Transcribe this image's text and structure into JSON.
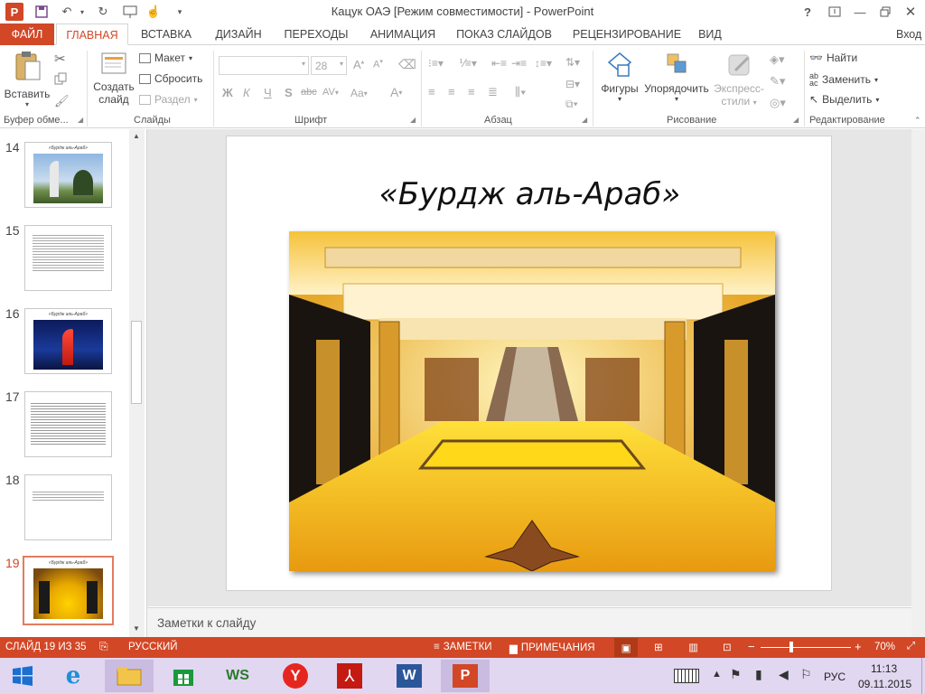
{
  "window": {
    "title": "Кацук ОАЭ [Режим совместимости] - PowerPoint"
  },
  "titlebar_right": {
    "help": "?"
  },
  "tabs": [
    "ФАЙЛ",
    "ГЛАВНАЯ",
    "ВСТАВКА",
    "ДИЗАЙН",
    "ПЕРЕХОДЫ",
    "АНИМАЦИЯ",
    "ПОКАЗ СЛАЙДОВ",
    "РЕЦЕНЗИРОВАНИЕ",
    "ВИД"
  ],
  "account": "Вход",
  "ribbon": {
    "clipboard": {
      "paste": "Вставить",
      "group": "Буфер обме..."
    },
    "slides": {
      "create": "Создать",
      "create2": "слайд",
      "layout": "Макет",
      "reset": "Сбросить",
      "section": "Раздел",
      "group": "Слайды"
    },
    "font": {
      "size": "28",
      "group": "Шрифт",
      "bold": "Ж",
      "italic": "К",
      "underline": "Ч",
      "shadow": "S",
      "strike": "abc",
      "spacing": "AV",
      "case": "Aa",
      "color": "A"
    },
    "paragraph": {
      "group": "Абзац"
    },
    "drawing": {
      "shapes": "Фигуры",
      "arrange": "Упорядочить",
      "styles": "Экспресс-",
      "styles2": "стили",
      "group": "Рисование"
    },
    "editing": {
      "find": "Найти",
      "replace": "Заменить",
      "select": "Выделить",
      "group": "Редактирование"
    }
  },
  "thumbnails": [
    {
      "num": "14",
      "title": "«Бурдж аль-Араб»"
    },
    {
      "num": "15",
      "title": ""
    },
    {
      "num": "16",
      "title": "«Бурдж аль-Араб»"
    },
    {
      "num": "17",
      "title": ""
    },
    {
      "num": "18",
      "title": ""
    },
    {
      "num": "19",
      "title": "«Бурдж аль-Араб»"
    }
  ],
  "slide": {
    "title": "«Бурдж аль-Араб»"
  },
  "notes": {
    "placeholder": "Заметки к слайду"
  },
  "status": {
    "slide_info": "СЛАЙД 19 ИЗ 35",
    "language": "РУССКИЙ",
    "notes": "ЗАМЕТКИ",
    "comments": "ПРИМЕЧАНИЯ",
    "zoom": "70%"
  },
  "taskbar": {
    "lang": "РУС",
    "time": "11:13",
    "date": "09.11.2015"
  },
  "colors": {
    "accent": "#d24726",
    "taskbar": "#e1d7f0"
  }
}
